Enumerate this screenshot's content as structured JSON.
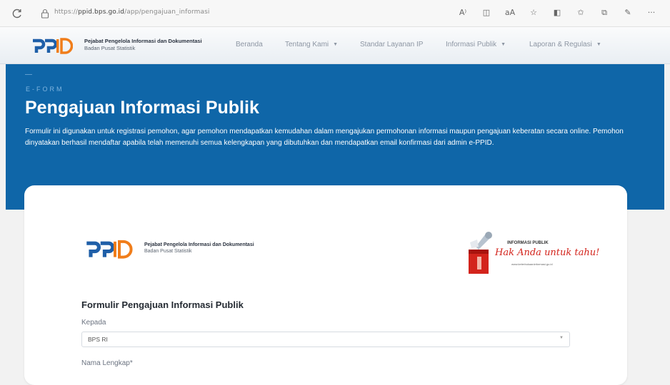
{
  "browser": {
    "url_scheme": "https://",
    "url_host": "ppid.bps.go.id",
    "url_path": "/app/pengajuan_informasi"
  },
  "navbar": {
    "logo_text": "PPID",
    "brand_title": "Pejabat Pengelola Informasi dan Dokumentasi",
    "brand_sub": "Badan Pusat Statistik",
    "items": [
      {
        "label": "Beranda",
        "dropdown": false
      },
      {
        "label": "Tentang Kami",
        "dropdown": true
      },
      {
        "label": "Standar Layanan IP",
        "dropdown": false
      },
      {
        "label": "Informasi Publik",
        "dropdown": true
      },
      {
        "label": "Laporan & Regulasi",
        "dropdown": true
      }
    ]
  },
  "hero": {
    "eyebrow": "E-FORM",
    "title": "Pengajuan Informasi Publik",
    "description": "Formulir ini digunakan untuk registrasi pemohon, agar pemohon mendapatkan kemudahan dalam mengajukan permohonan informasi maupun pengajuan keberatan secara online. Pemohon dinyatakan berhasil mendaftar apabila telah memenuhi semua kelengkapan yang dibutuhkan dan mendapatkan email konfirmasi dari admin e-PPID.",
    "background": "#0f66a8"
  },
  "card": {
    "brand_title": "Pejabat Pengelola Informasi dan Dokumentasi",
    "brand_sub": "Badan Pusat Statistik",
    "promo_label": "INFORMASI PUBLIK",
    "promo_slogan": "Hak Anda untuk tahu!",
    "promo_url": "www.keterbukaaninformasi.go.id",
    "form_title": "Formulir Pengajuan Informasi Publik",
    "field_kepada_label": "Kepada",
    "field_kepada_value": "BPS RI",
    "field_nama_label": "Nama Lengkap*"
  },
  "colors": {
    "brand_blue": "#1f5fa8",
    "brand_orange": "#f07d1a",
    "accent_red": "#d3241c"
  }
}
